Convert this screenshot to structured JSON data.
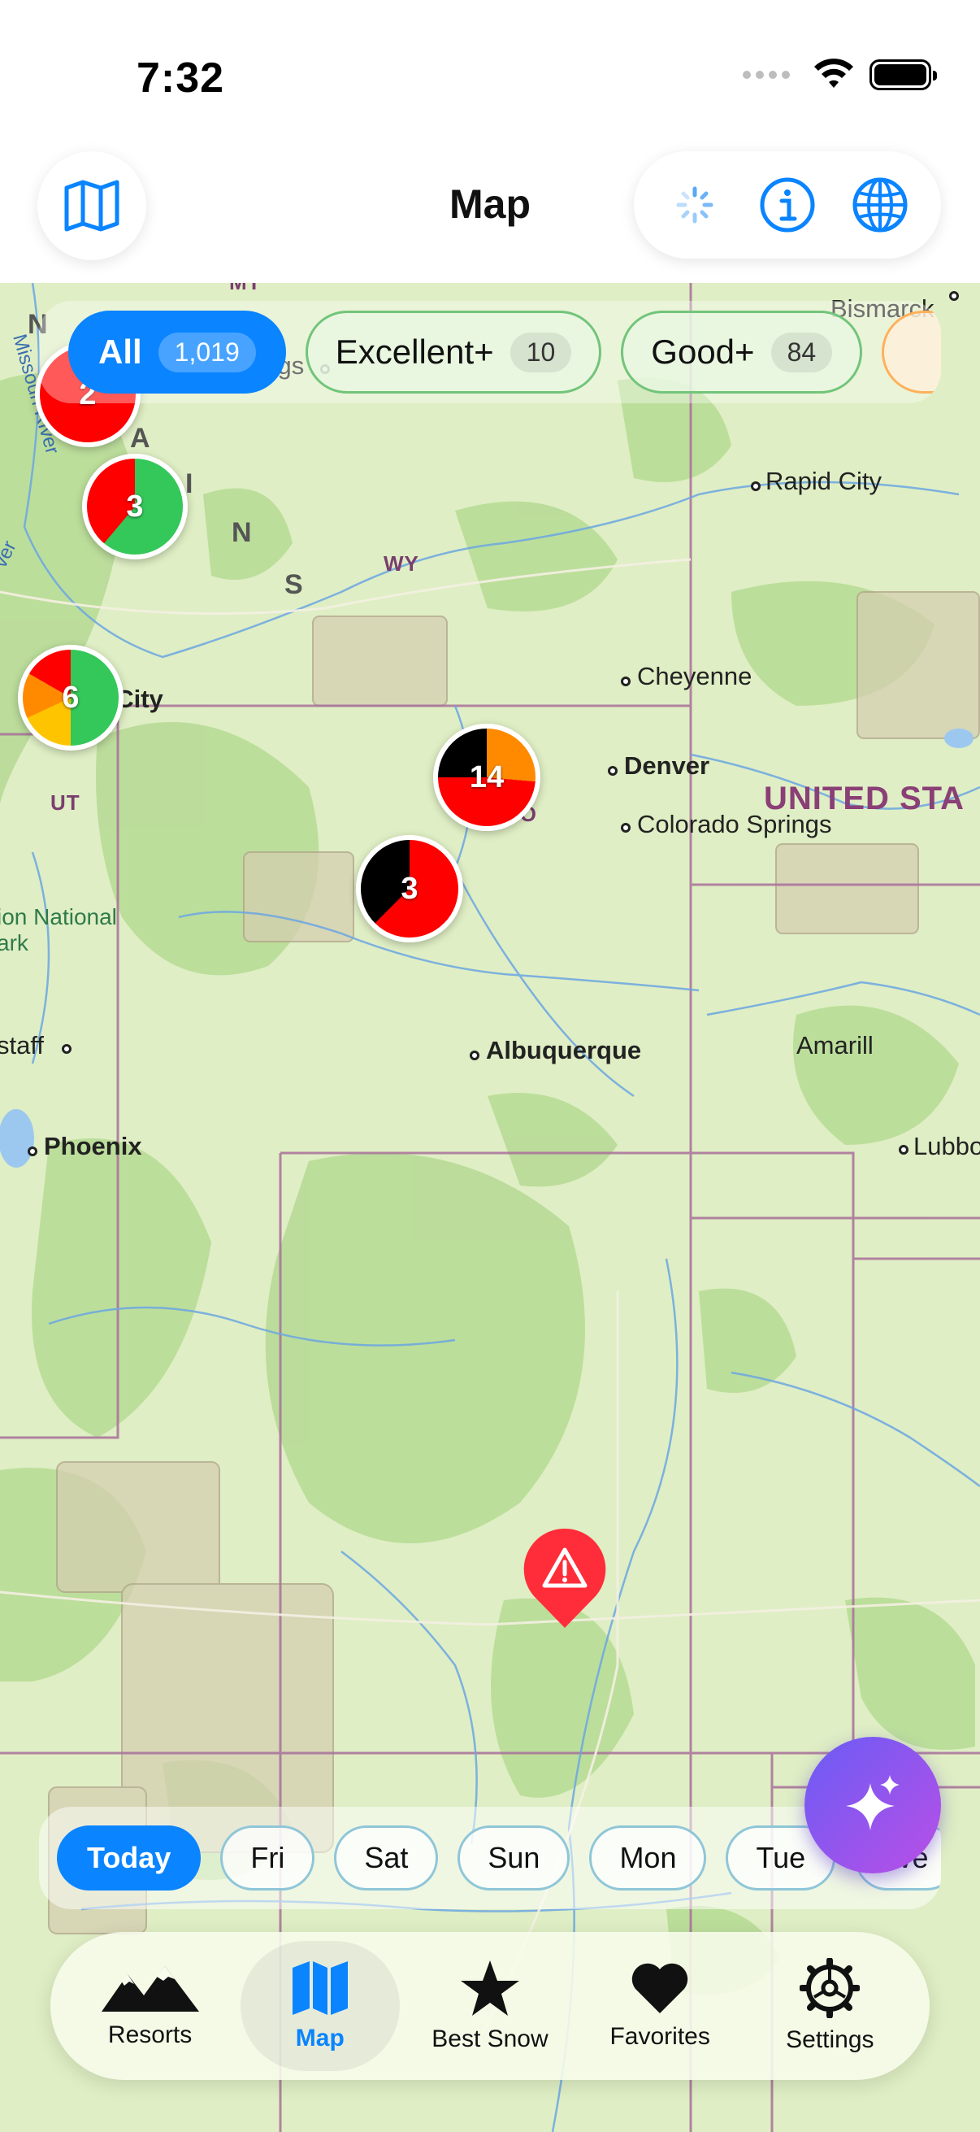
{
  "status_bar": {
    "time": "7:32"
  },
  "header": {
    "title": "Map",
    "left_icon": "map-icon",
    "right_icons": [
      "loading-spinner-icon",
      "info-icon",
      "globe-icon"
    ]
  },
  "filters": [
    {
      "label": "All",
      "count": "1,019",
      "active": true
    },
    {
      "label": "Excellent+",
      "count": "10",
      "active": false
    },
    {
      "label": "Good+",
      "count": "84",
      "active": false
    }
  ],
  "map": {
    "cities": [
      {
        "name": "Billings"
      },
      {
        "name": "Bismarck"
      },
      {
        "name": "Rapid City"
      },
      {
        "name": "Cheyenne"
      },
      {
        "name": "Denver"
      },
      {
        "name": "Colorado Springs"
      },
      {
        "name": "Albuquerque"
      },
      {
        "name": "Phoenix"
      },
      {
        "name": "Lubbock"
      },
      {
        "name": "Amarill"
      },
      {
        "name": "staff"
      },
      {
        "name": "t Lake City"
      }
    ],
    "states": {
      "mt": "MT",
      "wy": "WY",
      "ut": "UT",
      "co": "CO"
    },
    "country": "UNITED STA",
    "rivers": {
      "missouri": "Missouri River",
      "river_left": "ver"
    },
    "park": "ion National\nark",
    "range_letters": [
      "N",
      "A",
      "I",
      "N",
      "S"
    ],
    "edge_letter": "N",
    "clusters": [
      {
        "count": "2"
      },
      {
        "count": "3"
      },
      {
        "count": "6"
      },
      {
        "count": "14"
      },
      {
        "count": "3"
      }
    ],
    "alert_icon": "warning-icon"
  },
  "days": [
    {
      "label": "Today",
      "active": true
    },
    {
      "label": "Fri",
      "active": false
    },
    {
      "label": "Sat",
      "active": false
    },
    {
      "label": "Sun",
      "active": false
    },
    {
      "label": "Mon",
      "active": false
    },
    {
      "label": "Tue",
      "active": false
    },
    {
      "label": "We",
      "active": false
    }
  ],
  "ai_button_icon": "sparkles-icon",
  "tabs": [
    {
      "label": "Resorts",
      "icon": "mountains-icon",
      "active": false
    },
    {
      "label": "Map",
      "icon": "map-icon",
      "active": true
    },
    {
      "label": "Best Snow",
      "icon": "star-icon",
      "active": false
    },
    {
      "label": "Favorites",
      "icon": "heart-icon",
      "active": false
    },
    {
      "label": "Settings",
      "icon": "gear-icon",
      "active": false
    }
  ],
  "colors": {
    "accent": "#0a84ff",
    "excellent": "#34c759",
    "poor": "#ff0000",
    "fair": "#ff8a00",
    "moderate": "#ffc400",
    "none": "#000000",
    "map_land": "#dfeec4",
    "forest": "#b9dc9a",
    "border": "#a8709a",
    "water": "#6ba6e3"
  }
}
